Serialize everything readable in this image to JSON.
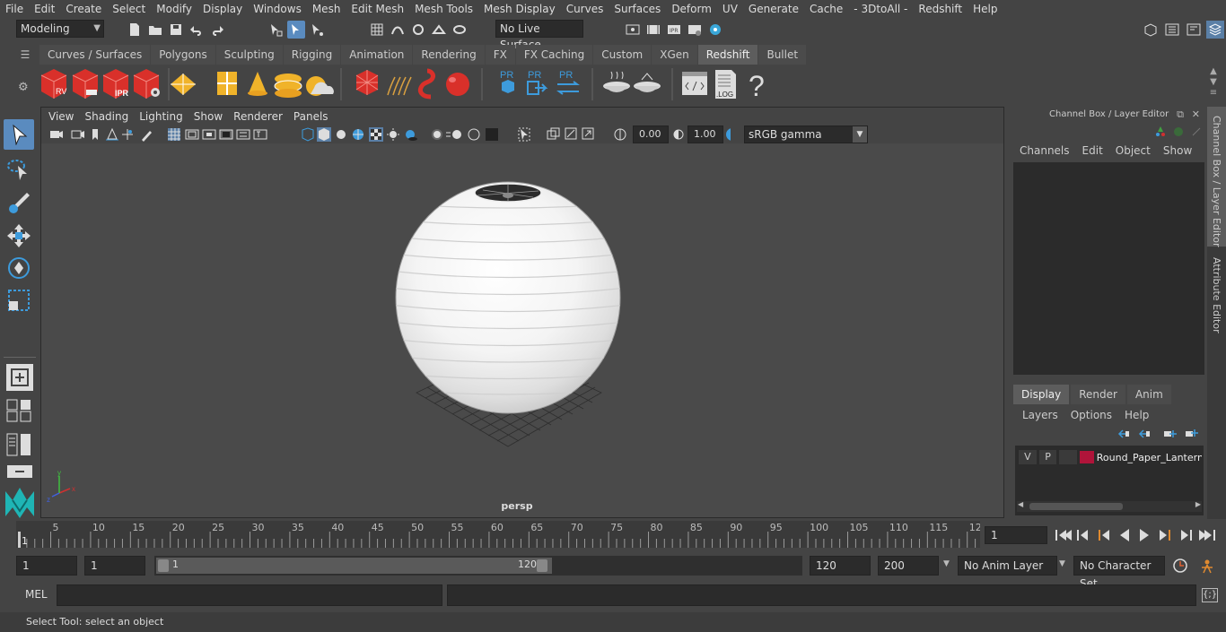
{
  "menubar": {
    "items": [
      "File",
      "Edit",
      "Create",
      "Select",
      "Modify",
      "Display",
      "Windows",
      "Mesh",
      "Edit Mesh",
      "Mesh Tools",
      "Mesh Display",
      "Curves",
      "Surfaces",
      "Deform",
      "UV",
      "Generate",
      "Cache",
      "- 3DtoAll -",
      "Redshift",
      "Help"
    ]
  },
  "statusline": {
    "mode": "Modeling",
    "live_surface": "No Live Surface"
  },
  "shelf": {
    "tabs": [
      "Curves / Surfaces",
      "Polygons",
      "Sculpting",
      "Rigging",
      "Animation",
      "Rendering",
      "FX",
      "FX Caching",
      "Custom",
      "XGen",
      "Redshift",
      "Bullet"
    ],
    "active_tab": "Redshift",
    "labels": {
      "rv": "RV",
      "ipr": "IPR",
      "pr": "PR",
      "log": ".LOG",
      "help": "?"
    }
  },
  "viewport": {
    "menus": [
      "View",
      "Shading",
      "Lighting",
      "Show",
      "Renderer",
      "Panels"
    ],
    "exposure": "0.00",
    "gamma": "1.00",
    "colorspace": "sRGB gamma",
    "camera_label": "persp"
  },
  "channelbox": {
    "title": "Channel Box / Layer Editor",
    "menus": [
      "Channels",
      "Edit",
      "Object",
      "Show"
    ],
    "layer_tabs": [
      "Display",
      "Render",
      "Anim"
    ],
    "active_layer_tab": "Display",
    "layer_menus": [
      "Layers",
      "Options",
      "Help"
    ],
    "layer": {
      "v": "V",
      "p": "P",
      "name": "Round_Paper_Lantern",
      "color": "#b0143a"
    }
  },
  "side_tabs": [
    "Channel Box / Layer Editor",
    "Attribute Editor"
  ],
  "timeline": {
    "ticks": [
      "5",
      "10",
      "15",
      "20",
      "25",
      "30",
      "35",
      "40",
      "45",
      "50",
      "55",
      "60",
      "65",
      "70",
      "75",
      "80",
      "85",
      "90",
      "95",
      "100",
      "105",
      "110",
      "115",
      "12"
    ],
    "start_marker": "1",
    "current_frame": "1"
  },
  "range": {
    "start": "1",
    "playback_start": "1",
    "slider_start": "1",
    "slider_end": "120",
    "playback_end": "120",
    "end": "200",
    "anim_layer": "No Anim Layer",
    "character_set": "No Character Set"
  },
  "cmdline": {
    "label": "MEL"
  },
  "helpline": {
    "text": "Select Tool: select an object"
  },
  "colors": {
    "accent_blue": "#4a90c8",
    "redshift_red": "#e03030",
    "selected_tab": "#5d5d5d"
  }
}
